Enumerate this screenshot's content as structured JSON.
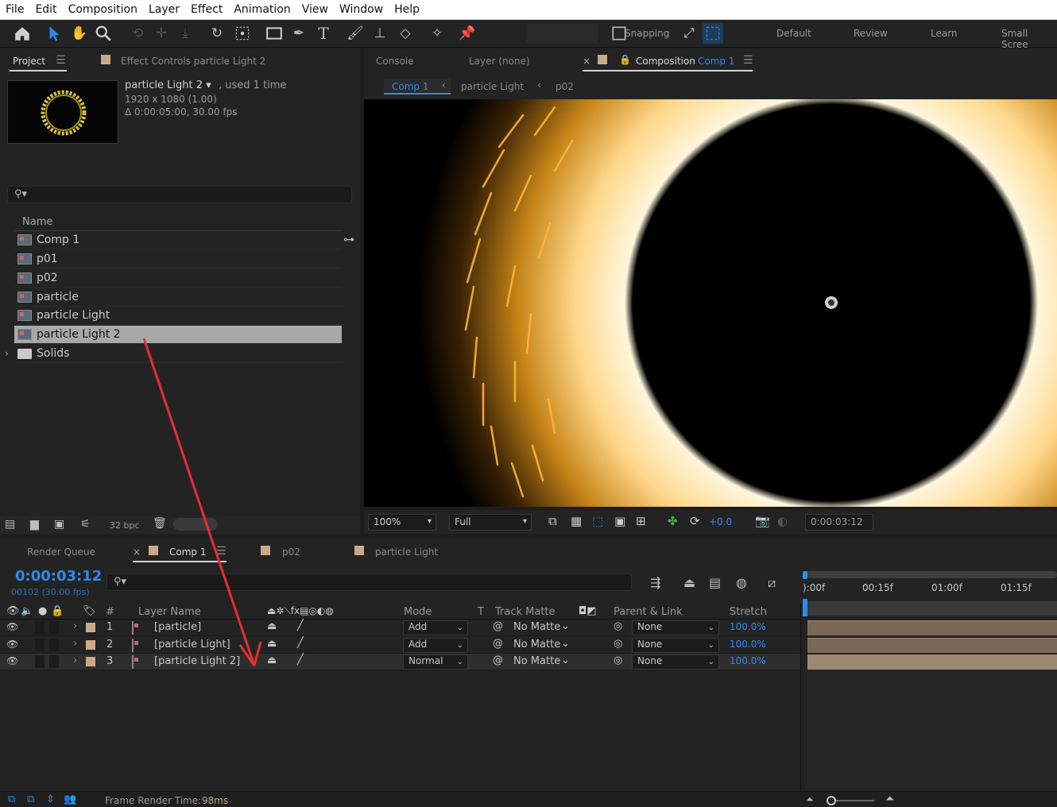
{
  "menu": [
    "File",
    "Edit",
    "Composition",
    "Layer",
    "Effect",
    "Animation",
    "View",
    "Window",
    "Help"
  ],
  "toolbar": {
    "snapping_label": "Snapping",
    "workspaces": [
      "Default",
      "Review",
      "Learn",
      "Small Scree"
    ]
  },
  "project_panel": {
    "tab_project": "Project",
    "tab_effect_controls": "Effect Controls particle Light 2",
    "item_name": "particle Light 2 ▾",
    "used": ", used 1 time",
    "resolution": "1920 x 1080 (1.00)",
    "duration": "Δ 0:00:05:00, 30.00 fps",
    "column_name": "Name",
    "items": [
      {
        "label": "Comp 1",
        "type": "comp"
      },
      {
        "label": "p01",
        "type": "comp"
      },
      {
        "label": "p02",
        "type": "comp"
      },
      {
        "label": "particle",
        "type": "comp"
      },
      {
        "label": "particle Light",
        "type": "comp"
      },
      {
        "label": "particle Light 2",
        "type": "comp",
        "selected": true
      },
      {
        "label": "Solids",
        "type": "folder"
      }
    ],
    "bpc": "32 bpc"
  },
  "viewer_panel": {
    "tab_console": "Console",
    "tab_layer": "Layer (none)",
    "tab_composition": "Composition",
    "tab_composition_name": "Comp 1",
    "breadcrumbs": [
      "Comp 1",
      "particle Light",
      "p02"
    ],
    "zoom": "100%",
    "resolution": "Full",
    "exposure": "+0.0",
    "timecode": "0:00:03:12"
  },
  "timeline_panel": {
    "tabs": [
      "Render Queue",
      "Comp 1",
      "p02",
      "particle Light"
    ],
    "timecode": "0:00:03:12",
    "frame_info": "00102 (30.00 fps)",
    "headers": {
      "number": "#",
      "layer_name": "Layer Name",
      "mode": "Mode",
      "t": "T",
      "track_matte": "Track Matte",
      "parent_link": "Parent & Link",
      "stretch": "Stretch"
    },
    "ruler": [
      "):00f",
      "00:15f",
      "01:00f",
      "01:15f"
    ],
    "layers": [
      {
        "num": "1",
        "name": "[particle]",
        "mode": "Add",
        "matte": "No Matte",
        "parent": "None",
        "stretch": "100.0%"
      },
      {
        "num": "2",
        "name": "[particle Light]",
        "mode": "Add",
        "matte": "No Matte",
        "parent": "None",
        "stretch": "100.0%"
      },
      {
        "num": "3",
        "name": "[particle Light 2]",
        "mode": "Normal",
        "matte": "No Matte",
        "parent": "None",
        "stretch": "100.0%"
      }
    ],
    "status": "Frame Render Time:",
    "render_time": "98ms"
  },
  "colors": {
    "accent": "#2d8ceb",
    "label": "#c9a98a",
    "annotation": "#e52f2f"
  }
}
